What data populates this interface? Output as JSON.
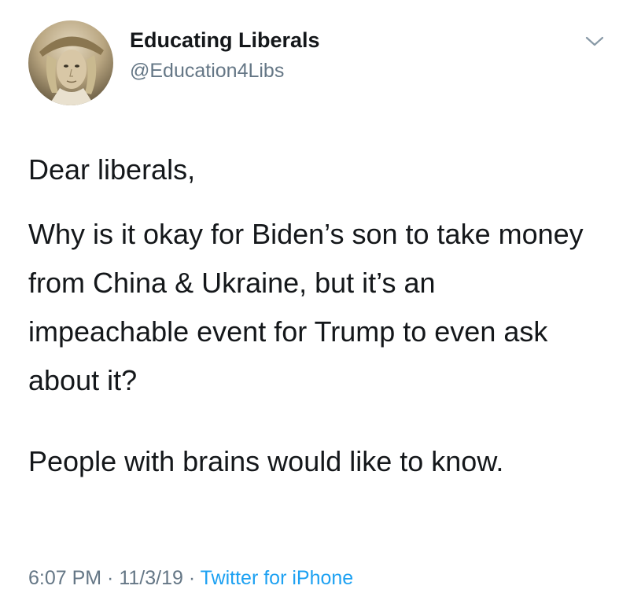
{
  "tweet": {
    "display_name": "Educating Liberals",
    "handle": "@Education4Libs",
    "paragraphs": [
      "Dear liberals,",
      "Why is it okay for Biden’s son to take money from China & Ukraine, but it’s an impeachable event for Trump to even ask about it?",
      "People with brains would like to know."
    ],
    "time": "6:07 PM",
    "date": "11/3/19",
    "separator": " · ",
    "source": "Twitter for iPhone"
  },
  "icons": {
    "menu": "chevron-down-icon",
    "avatar": "profile-photo"
  },
  "colors": {
    "text": "#14171a",
    "secondary": "#657786",
    "link": "#1da1f2",
    "background": "#ffffff"
  }
}
